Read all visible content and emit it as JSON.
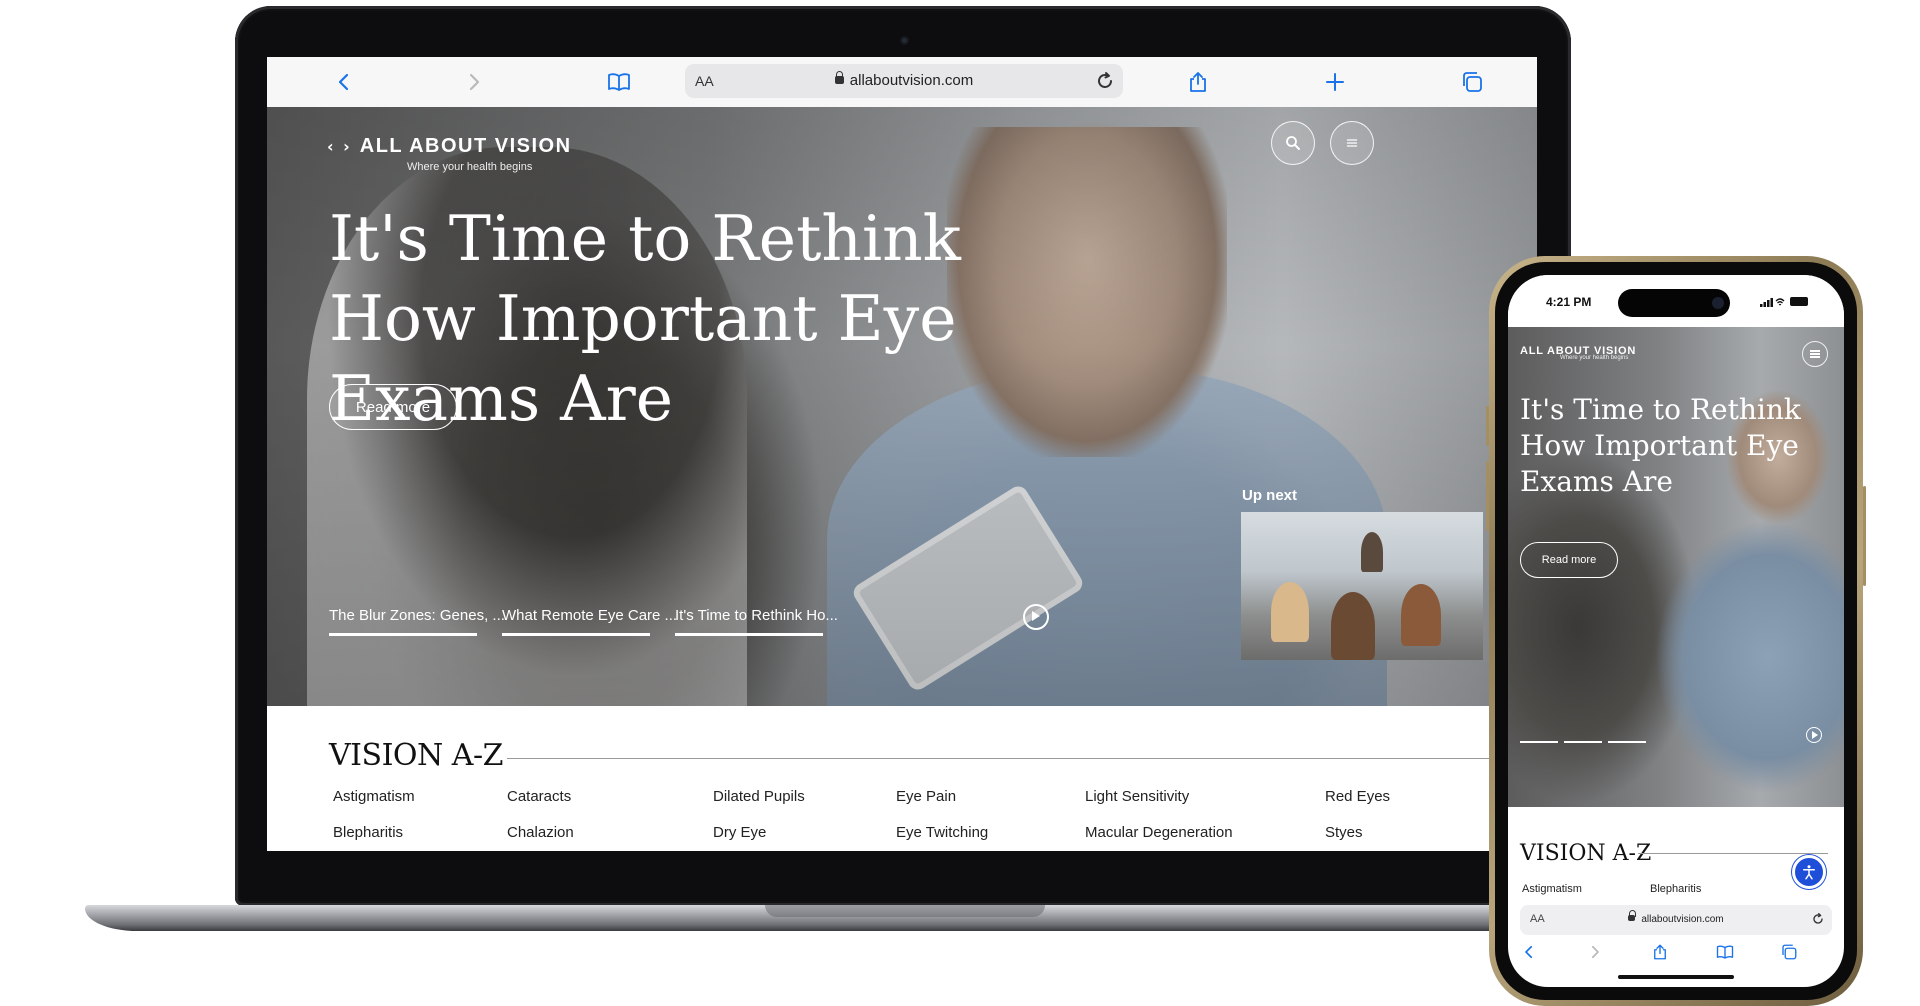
{
  "laptop": {
    "browser": {
      "url_prefix": "AA",
      "url": "allaboutvision.com"
    },
    "site": {
      "logo_arrows": "‹ ›",
      "logo_name": "ALL ABOUT VISION",
      "logo_tagline": "Where your health begins",
      "hero_title": "It's Time to Rethink How Important Eye Exams Are",
      "read_more": "Read more",
      "up_next": "Up next",
      "hero_tabs": [
        "The Blur Zones: Genes, ...",
        "What Remote Eye Care ...",
        "It's Time to Rethink Ho..."
      ],
      "active_tab_index": 2,
      "vision_az_title": "VISION A-Z",
      "vision_az_items": [
        [
          "Astigmatism",
          "Cataracts",
          "Dilated Pupils",
          "Eye Pain",
          "Light Sensitivity",
          "Red Eyes"
        ],
        [
          "Blepharitis",
          "Chalazion",
          "Dry Eye",
          "Eye Twitching",
          "Macular Degeneration",
          "Styes"
        ]
      ]
    }
  },
  "phone": {
    "status_time": "4:21 PM",
    "site": {
      "logo_name": "ALL ABOUT VISION",
      "logo_tagline": "Where your health begins",
      "hero_title": "It's Time to Rethink How Important Eye Exams Are",
      "read_more": "Read more",
      "vision_az_title": "VISION A-Z",
      "vision_az_items": [
        "Astigmatism",
        "Blepharitis"
      ]
    },
    "browser": {
      "url_prefix": "AA",
      "url": "allaboutvision.com"
    }
  },
  "colors": {
    "accent_blue": "#2b59ff",
    "phone_frame": "#b8a57b",
    "safari_icon_blue": "#1a73e8"
  }
}
